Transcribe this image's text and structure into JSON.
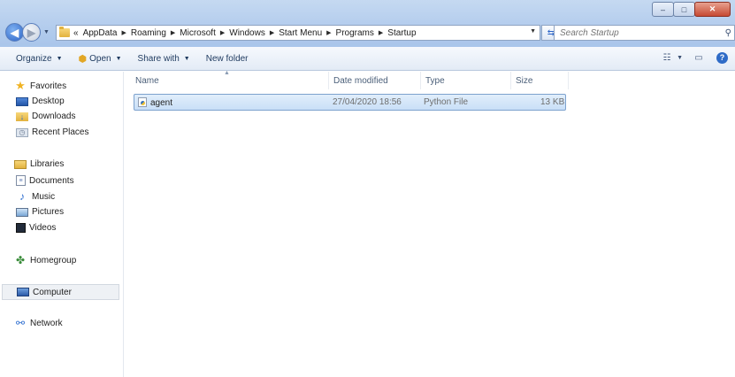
{
  "window": {
    "minimize": "‒",
    "maximize": "□",
    "close": "✕"
  },
  "address": {
    "overflow": "«",
    "crumbs": [
      "AppData",
      "Roaming",
      "Microsoft",
      "Windows",
      "Start Menu",
      "Programs",
      "Startup"
    ]
  },
  "search": {
    "placeholder": "Search Startup"
  },
  "toolbar": {
    "organize": "Organize",
    "open": "Open",
    "share_with": "Share with",
    "new_folder": "New folder"
  },
  "navpane": {
    "favorites": "Favorites",
    "desktop": "Desktop",
    "downloads": "Downloads",
    "recent_places": "Recent Places",
    "libraries": "Libraries",
    "documents": "Documents",
    "music": "Music",
    "pictures": "Pictures",
    "videos": "Videos",
    "homegroup": "Homegroup",
    "computer": "Computer",
    "network": "Network"
  },
  "columns": {
    "name": "Name",
    "date_modified": "Date modified",
    "type": "Type",
    "size": "Size"
  },
  "files": [
    {
      "name": "agent",
      "date_modified": "27/04/2020 18:56",
      "type": "Python File",
      "size": "13 KB"
    }
  ],
  "colors": {
    "selection": "#cce4f7",
    "chrome": "#b9d1ea",
    "accent": "#2c64c7"
  }
}
